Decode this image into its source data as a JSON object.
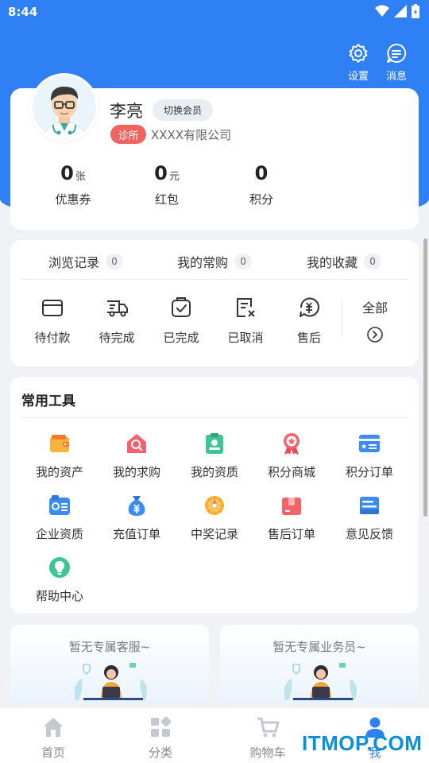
{
  "status": {
    "time": "8:44"
  },
  "header": {
    "settings_label": "设置",
    "messages_label": "消息"
  },
  "profile": {
    "name": "李亮",
    "switch_label": "切换会员",
    "badge": "诊所",
    "company": "XXXX有限公司",
    "stats": [
      {
        "value": "0",
        "unit": "张",
        "label": "优惠券"
      },
      {
        "value": "0",
        "unit": "元",
        "label": "红包"
      },
      {
        "value": "0",
        "unit": "",
        "label": "积分"
      }
    ]
  },
  "records": [
    {
      "label": "浏览记录",
      "count": "0"
    },
    {
      "label": "我的常购",
      "count": "0"
    },
    {
      "label": "我的收藏",
      "count": "0"
    }
  ],
  "orders": [
    {
      "label": "待付款",
      "icon": "wallet-icon"
    },
    {
      "label": "待完成",
      "icon": "delivery-truck-icon"
    },
    {
      "label": "已完成",
      "icon": "checked-bag-icon"
    },
    {
      "label": "已取消",
      "icon": "cancel-doc-icon"
    },
    {
      "label": "售后",
      "icon": "after-sale-icon"
    }
  ],
  "orders_all_label": "全部",
  "tools": {
    "title": "常用工具",
    "items": [
      {
        "label": "我的资产",
        "icon": "wallet-color-icon"
      },
      {
        "label": "我的求购",
        "icon": "search-house-icon"
      },
      {
        "label": "我的资质",
        "icon": "certificate-icon"
      },
      {
        "label": "积分商城",
        "icon": "medal-icon"
      },
      {
        "label": "积分订单",
        "icon": "card-icon"
      },
      {
        "label": "企业资质",
        "icon": "business-card-icon"
      },
      {
        "label": "充值订单",
        "icon": "money-bag-icon"
      },
      {
        "label": "中奖记录",
        "icon": "prize-wheel-icon"
      },
      {
        "label": "售后订单",
        "icon": "gift-box-icon"
      },
      {
        "label": "意见反馈",
        "icon": "feedback-icon"
      },
      {
        "label": "帮助中心",
        "icon": "lightbulb-icon"
      }
    ]
  },
  "services": {
    "customer_service": "暂无专属客服~",
    "salesperson": "暂无专属业务员~"
  },
  "nav": [
    {
      "label": "首页",
      "icon": "home-icon"
    },
    {
      "label": "分类",
      "icon": "category-icon"
    },
    {
      "label": "购物车",
      "icon": "cart-icon"
    },
    {
      "label": "我",
      "icon": "user-icon"
    }
  ],
  "colors": {
    "primary": "#2f80f5",
    "badge": "#f0645f",
    "background": "#f1f2f6"
  },
  "watermark": "ITMOP.COM"
}
